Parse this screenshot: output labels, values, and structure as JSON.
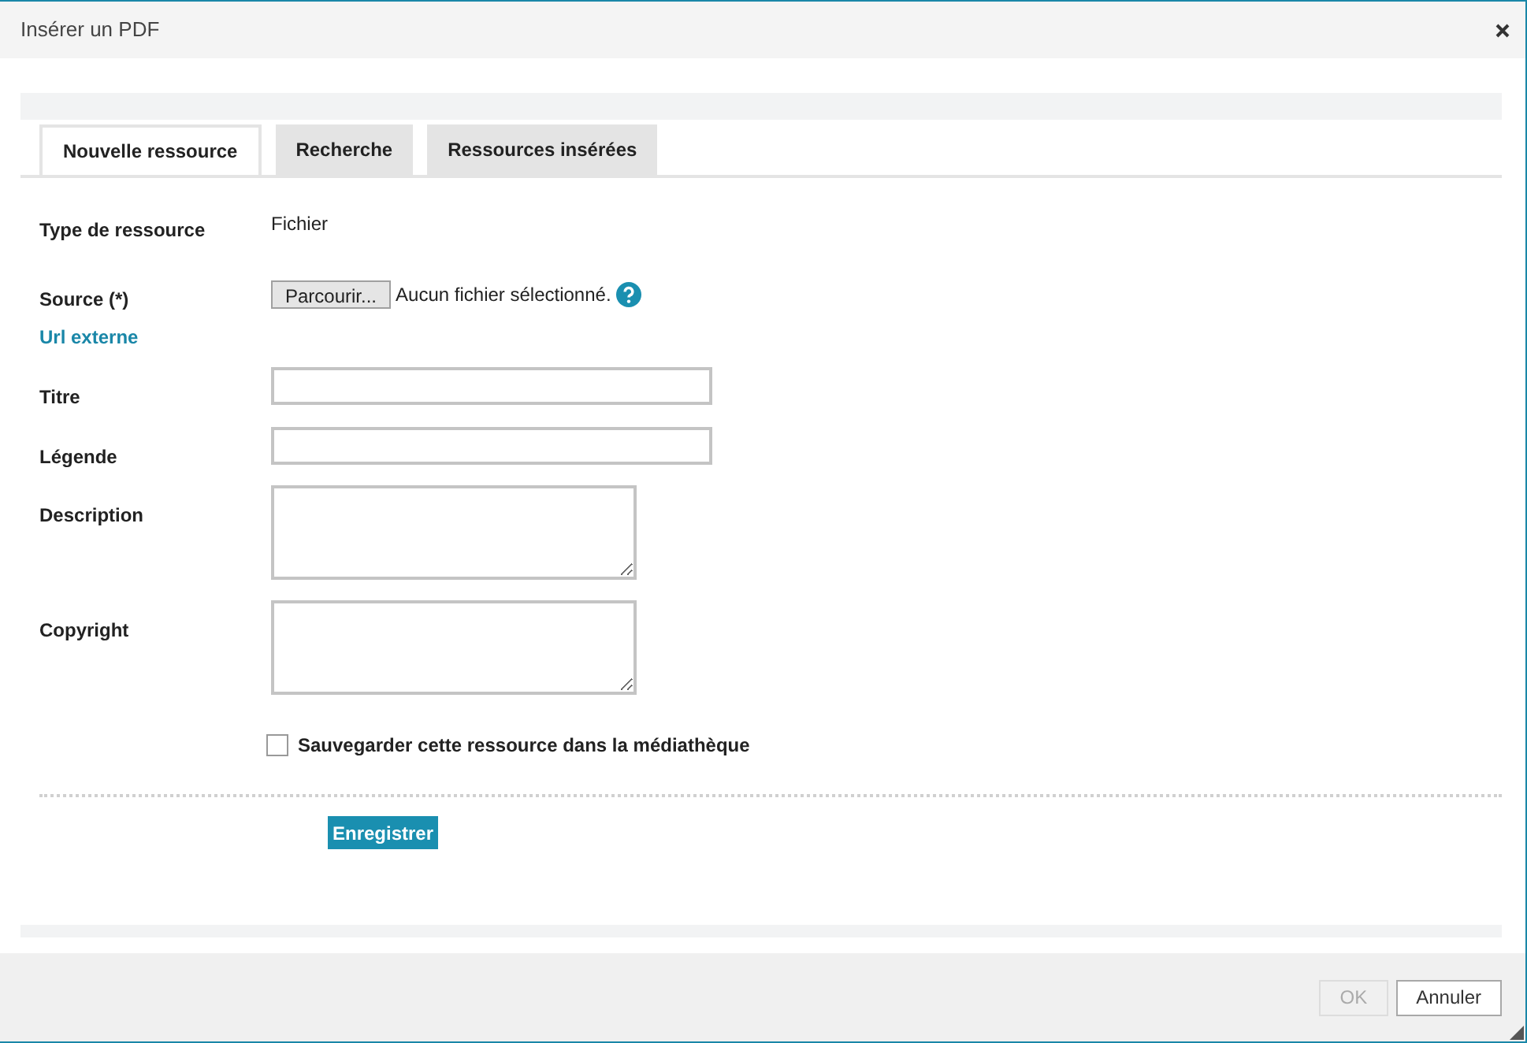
{
  "window": {
    "title": "Insérer un PDF"
  },
  "tabs": [
    {
      "label": "Nouvelle ressource",
      "selected": true
    },
    {
      "label": "Recherche",
      "selected": false
    },
    {
      "label": "Ressources insérées",
      "selected": false
    }
  ],
  "fields": [
    {
      "kind": "static",
      "label": "Type de ressource",
      "value": "Fichier"
    },
    {
      "kind": "file",
      "label": "Source (*)",
      "button": "Parcourir...",
      "status": "Aucun fichier sélectionné.",
      "link": "Url externe"
    },
    {
      "kind": "input",
      "label": "Titre"
    },
    {
      "kind": "input",
      "label": "Légende"
    },
    {
      "kind": "textarea",
      "label": "Description"
    },
    {
      "kind": "textarea",
      "label": "Copyright"
    }
  ],
  "save_option": {
    "label": "Sauvegarder cette ressource dans la médiathèque",
    "checked": false
  },
  "submit_button": "Enregistrer",
  "footer_buttons": [
    {
      "label": "OK",
      "disabled": true
    },
    {
      "label": "Annuler",
      "disabled": false
    }
  ]
}
